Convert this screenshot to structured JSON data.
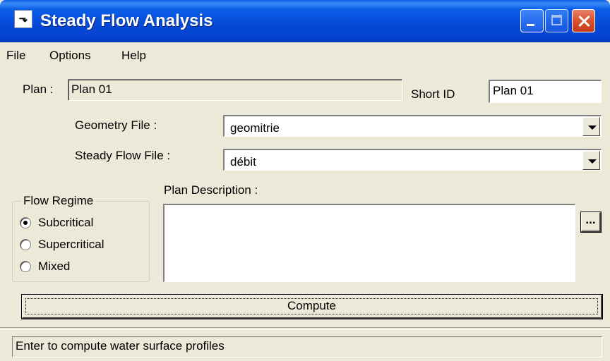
{
  "window": {
    "title": "Steady Flow Analysis"
  },
  "titlebar": {
    "app_icon_glyph": "⬎",
    "buttons": [
      "minimize-icon",
      "maximize-icon",
      "close-icon"
    ]
  },
  "menu": [
    "File",
    "Options",
    "Help"
  ],
  "plan": {
    "label": "Plan :",
    "value": "Plan 01"
  },
  "short_id": {
    "label": "Short ID",
    "value": "Plan 01"
  },
  "geometry": {
    "label": "Geometry File :",
    "value": "geomitrie"
  },
  "steady_flow": {
    "label": "Steady Flow File :",
    "value": "débit"
  },
  "flow_regime": {
    "title": "Flow Regime",
    "options": [
      "Subcritical",
      "Supercritical",
      "Mixed"
    ],
    "selected": "Subcritical"
  },
  "plan_description": {
    "label": "Plan Description :",
    "value": "",
    "ellipsis": "..."
  },
  "compute_label": "Compute",
  "status": "Enter to compute water surface profiles"
}
